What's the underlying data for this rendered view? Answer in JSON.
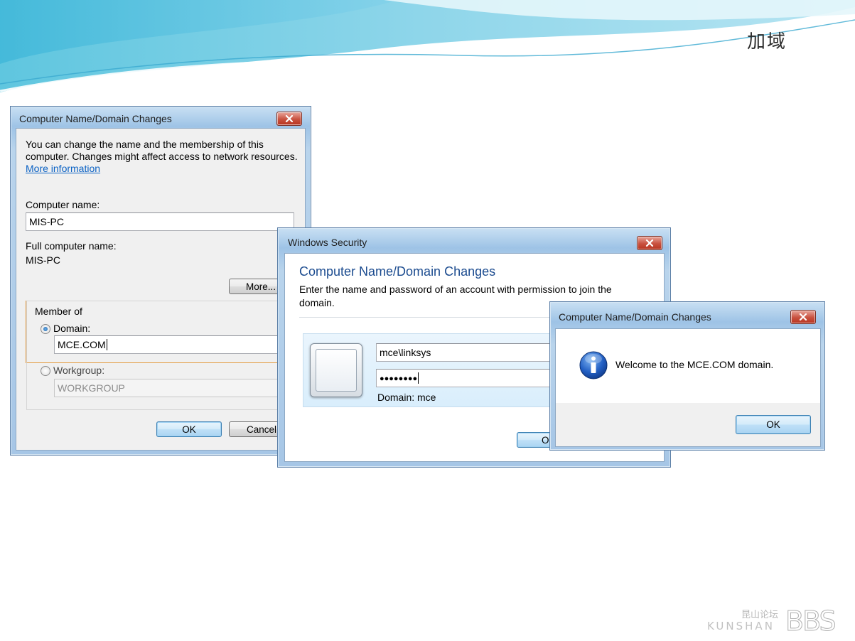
{
  "slide": {
    "title": "加域"
  },
  "dialog_main": {
    "title": "Computer Name/Domain Changes",
    "description_line1": "You can change the name and the membership of this",
    "description_line2": "computer. Changes might affect access to network resources.",
    "more_info_link": "More information",
    "computer_name_label": "Computer name:",
    "computer_name_value": "MIS-PC",
    "full_name_label": "Full computer name:",
    "full_name_value": "MIS-PC",
    "more_button": "More...",
    "member_of_label": "Member of",
    "domain_label": "Domain:",
    "domain_value": "MCE.COM",
    "workgroup_label": "Workgroup:",
    "workgroup_value": "WORKGROUP",
    "ok_button": "OK",
    "cancel_button": "Cancel"
  },
  "dialog_security": {
    "title": "Windows Security",
    "heading": "Computer Name/Domain Changes",
    "prompt_line1": "Enter the name and password of an account with permission to join the",
    "prompt_line2": "domain.",
    "username_value": "mce\\linksys",
    "password_value": "●●●●●●●●",
    "domain_hint": "Domain: mce",
    "ok_button": "O"
  },
  "dialog_welcome": {
    "title": "Computer Name/Domain Changes",
    "message": "Welcome to the MCE.COM domain.",
    "ok_button": "OK"
  },
  "watermark": {
    "cn": "昆山论坛",
    "en": "KUNSHAN",
    "brand": "BBS"
  },
  "colors": {
    "link": "#0b62c4",
    "heading": "#1b4b8f",
    "highlight_border": "#e39a3c"
  }
}
